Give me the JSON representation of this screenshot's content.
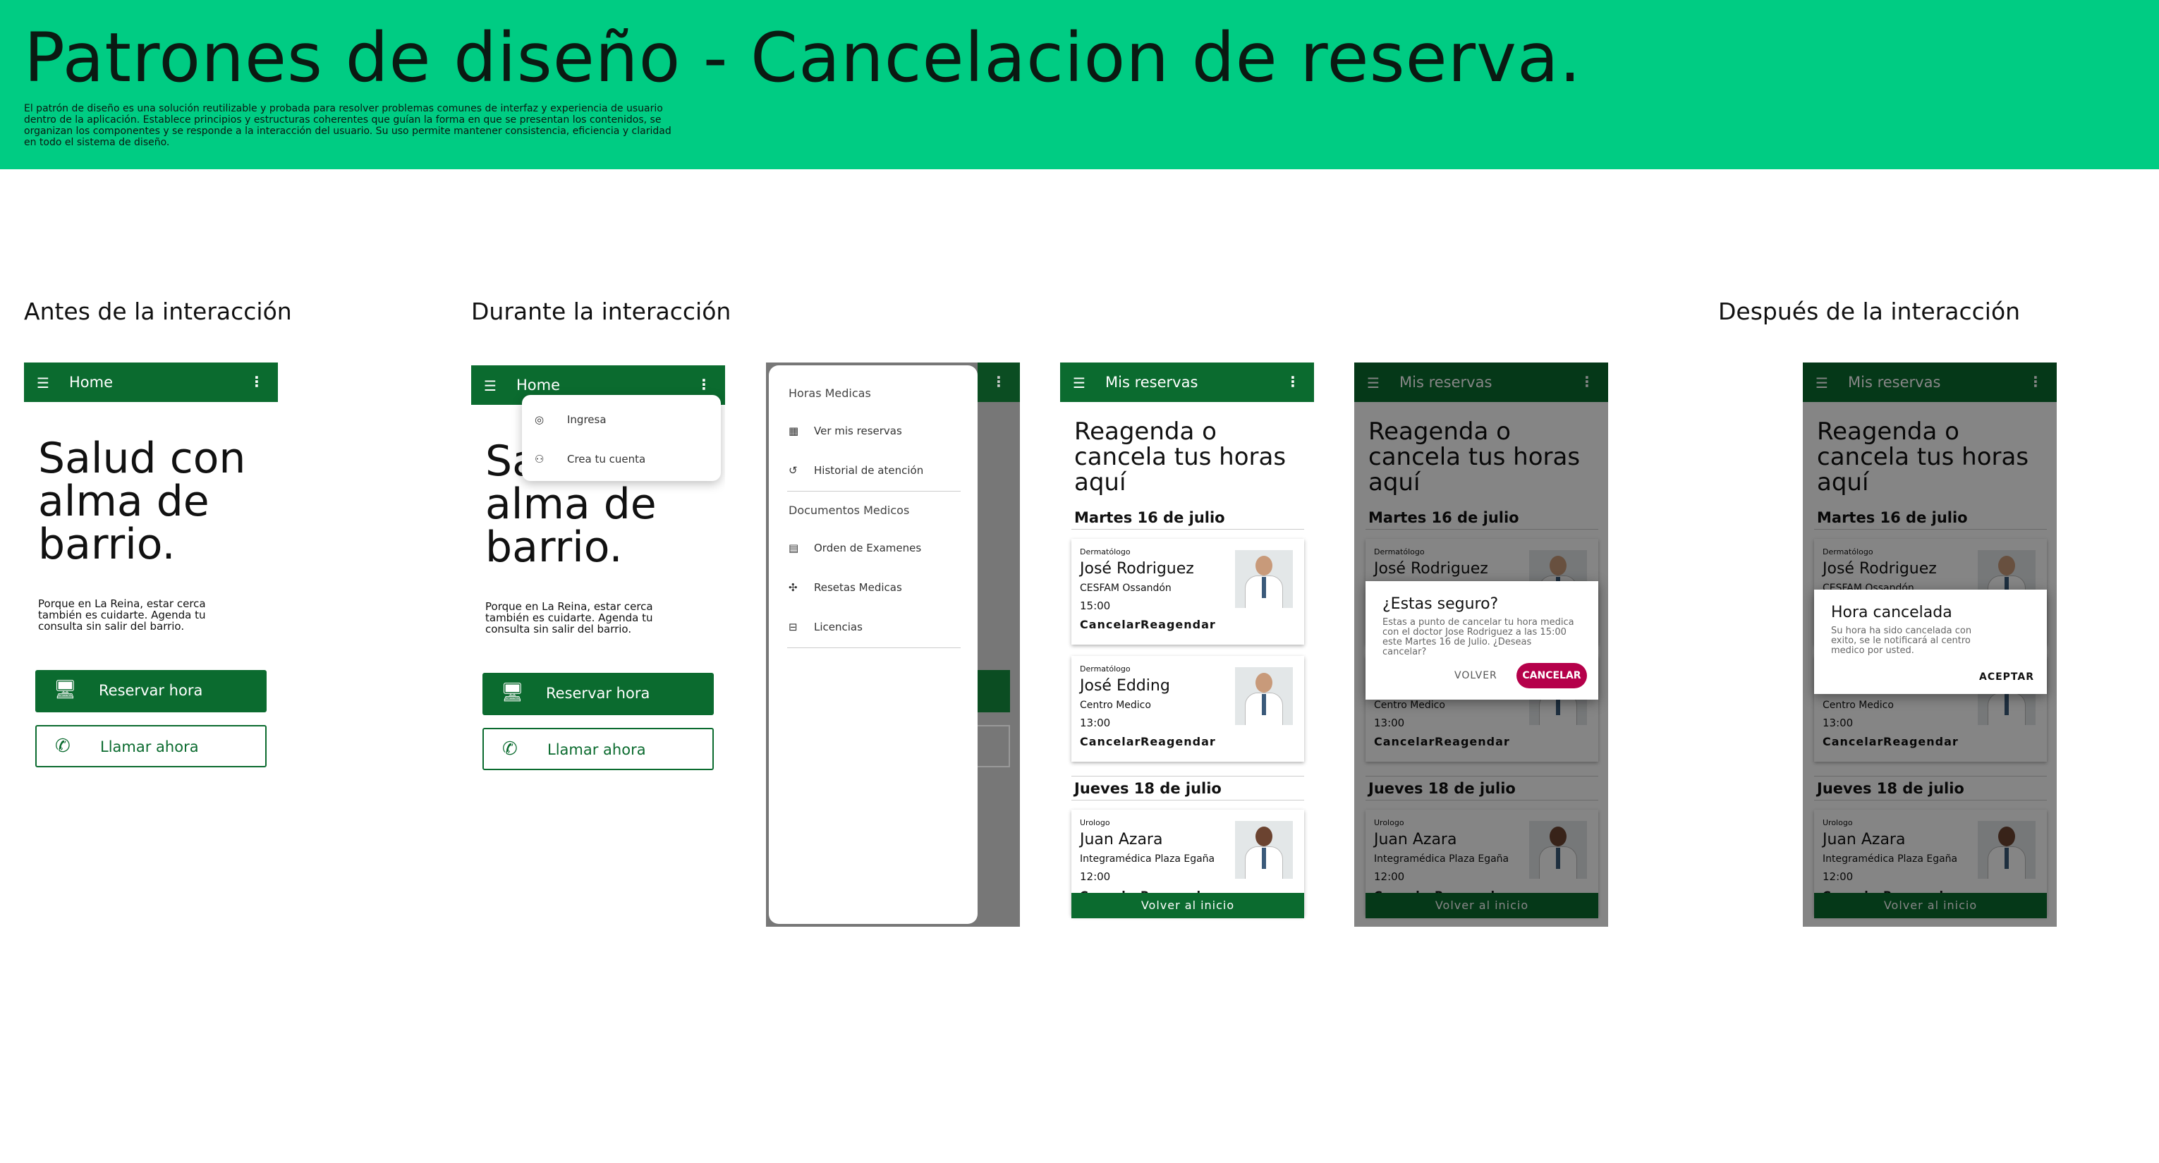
{
  "header": {
    "title": "Patrones de diseño - Cancelacion de reserva.",
    "description": "El patrón de diseño es una solución reutilizable y probada para resolver problemas comunes de interfaz y experiencia de usuario dentro de la aplicación. Establece principios y estructuras coherentes que guían la forma en que se presentan los contenidos, se organizan los componentes y se responde a la interacción del usuario. Su uso permite mantener consistencia, eficiencia y claridad en todo el sistema de diseño."
  },
  "sections": {
    "before": "Antes de la interacción",
    "during": "Durante la interacción",
    "after": "Después de la interacción"
  },
  "home": {
    "title": "Home",
    "hero_1": "Salud con",
    "hero_2": "alma de",
    "hero_3": "barrio.",
    "hero_partial": "Sa",
    "tagline": "Porque en La Reina, estar cerca también es cuidarte. Agenda tu consulta sin salir del barrio.",
    "reserve": "Reservar hora",
    "call": "Llamar ahora"
  },
  "account_menu": {
    "login": "Ingresa",
    "create": "Crea tu cuenta"
  },
  "drawer": {
    "group1": "Horas Medicas",
    "item1": "Ver mis reservas",
    "item2": "Historial de atención",
    "group2": "Documentos Medicos",
    "item3": "Orden de Examenes",
    "item4": "Resetas Medicas",
    "item5": "Licencias"
  },
  "reservas": {
    "title": "Mis reservas",
    "heading_1": "Reagenda o",
    "heading_2": "cancela tus horas",
    "heading_3": "aquí",
    "day1": "Martes 16 de julio",
    "day2": "Jueves 18 de julio",
    "cancel": "Cancelar",
    "reschedule": "Reagendar",
    "back": "Volver al inicio",
    "cards": [
      {
        "specialty": "Dermatólogo",
        "name": "José Rodriguez",
        "clinic": "CESFAM Ossandón",
        "time": "15:00"
      },
      {
        "specialty": "Dermatólogo",
        "name": "José Edding",
        "clinic": "Centro Medico",
        "time": "13:00"
      },
      {
        "specialty": "Urologo",
        "name": "Juan Azara",
        "clinic": "Integramédica Plaza Egaña",
        "time": "12:00"
      }
    ]
  },
  "confirm": {
    "title": "¿Estas seguro?",
    "body": "Estas a punto de cancelar tu hora medica con el doctor Jose Rodriguez a las 15:00 este Martes 16 de Julio. ¿Deseas cancelar?",
    "back": "VOLVER",
    "cancel": "CANCELAR"
  },
  "done": {
    "title": "Hora cancelada",
    "body": "Su hora ha sido cancelada con exito, se le notificará al centro medico por usted.",
    "accept": "ACEPTAR"
  },
  "icons": {
    "menu": "hamburger-icon",
    "more": "more-vert-icon",
    "monitor": "monitor-icon",
    "phone": "phone-icon",
    "user": "user-icon",
    "add_user": "add-user-icon",
    "calendar": "calendar-icon",
    "history": "history-icon",
    "document": "document-icon",
    "pills": "pills-icon",
    "bed": "bed-icon"
  },
  "colors": {
    "banner": "#00cc83",
    "primary": "#0b6b2f",
    "danger": "#b5004a"
  }
}
